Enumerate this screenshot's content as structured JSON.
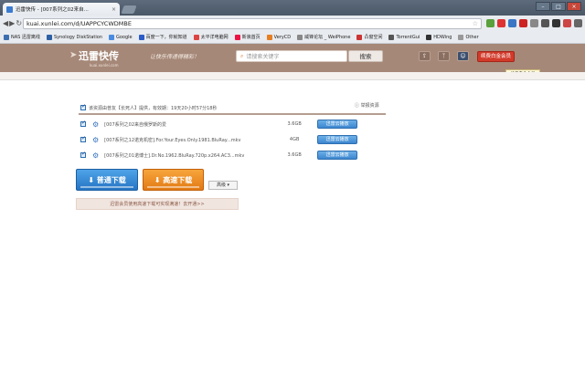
{
  "browser": {
    "tab_title": "迅雷快传 - [007系列之02来自...",
    "tab_close": "×",
    "new_tab": "",
    "url": "kuai.xunlei.com/d/UAPPCYCWDMBE",
    "win_min": "–",
    "win_max": "□",
    "win_close": "×"
  },
  "bookmarks": [
    {
      "label": "NAS 迅雷离线",
      "color": "#3d6fb0"
    },
    {
      "label": "Synology DiskStation",
      "color": "#2d5fa5"
    },
    {
      "label": "Google",
      "color": "#4a8be0"
    },
    {
      "label": "百度一下，你就知道",
      "color": "#2b5cc8"
    },
    {
      "label": "太平洋电脑网",
      "color": "#d44"
    },
    {
      "label": "新浪首页",
      "color": "#e14"
    },
    {
      "label": "VeryCD",
      "color": "#e67e22"
    },
    {
      "label": "威锋论坛 _ WeiPhone",
      "color": "#888"
    },
    {
      "label": "凸窗空间",
      "color": "#c33"
    },
    {
      "label": "TorrentGui",
      "color": "#555"
    },
    {
      "label": "HDWing",
      "color": "#333"
    },
    {
      "label": "Other",
      "color": "#999"
    }
  ],
  "site": {
    "logo": "迅雷快传",
    "logo_sub": "kuai.xunlei.com",
    "slogan": "让快乐传递得精彩！",
    "search_placeholder": "请搜索关键字",
    "search_button": "搜索",
    "vip_button": "续费白金会员",
    "vip_tooltip": "续费白金会员"
  },
  "notice": {
    "text": "该资源由普友【长死人】提供，有效期：19天20小时57分18秒",
    "report": "举报资源"
  },
  "files": [
    {
      "name": "[007系列之02来自俄罗斯的爱",
      "size": "3.6GB",
      "action": "迅雷云播放"
    },
    {
      "name": "[007系列之12诺克机密].For.Your.Eyes.Only.1981.BluRay...mkv",
      "size": "4GB",
      "action": "迅雷云播放"
    },
    {
      "name": "[007系列之01诺博士].Dr.No.1962.BluRay.720p.x264.AC3...mkv",
      "size": "3.6GB",
      "action": "迅雷云播放"
    }
  ],
  "actions": {
    "normal_download": "普通下载",
    "fast_download": "高速下载",
    "mode": "高级 ▾",
    "promo": "迅雷会员使用高速下载可实现满速！去开通>>"
  }
}
